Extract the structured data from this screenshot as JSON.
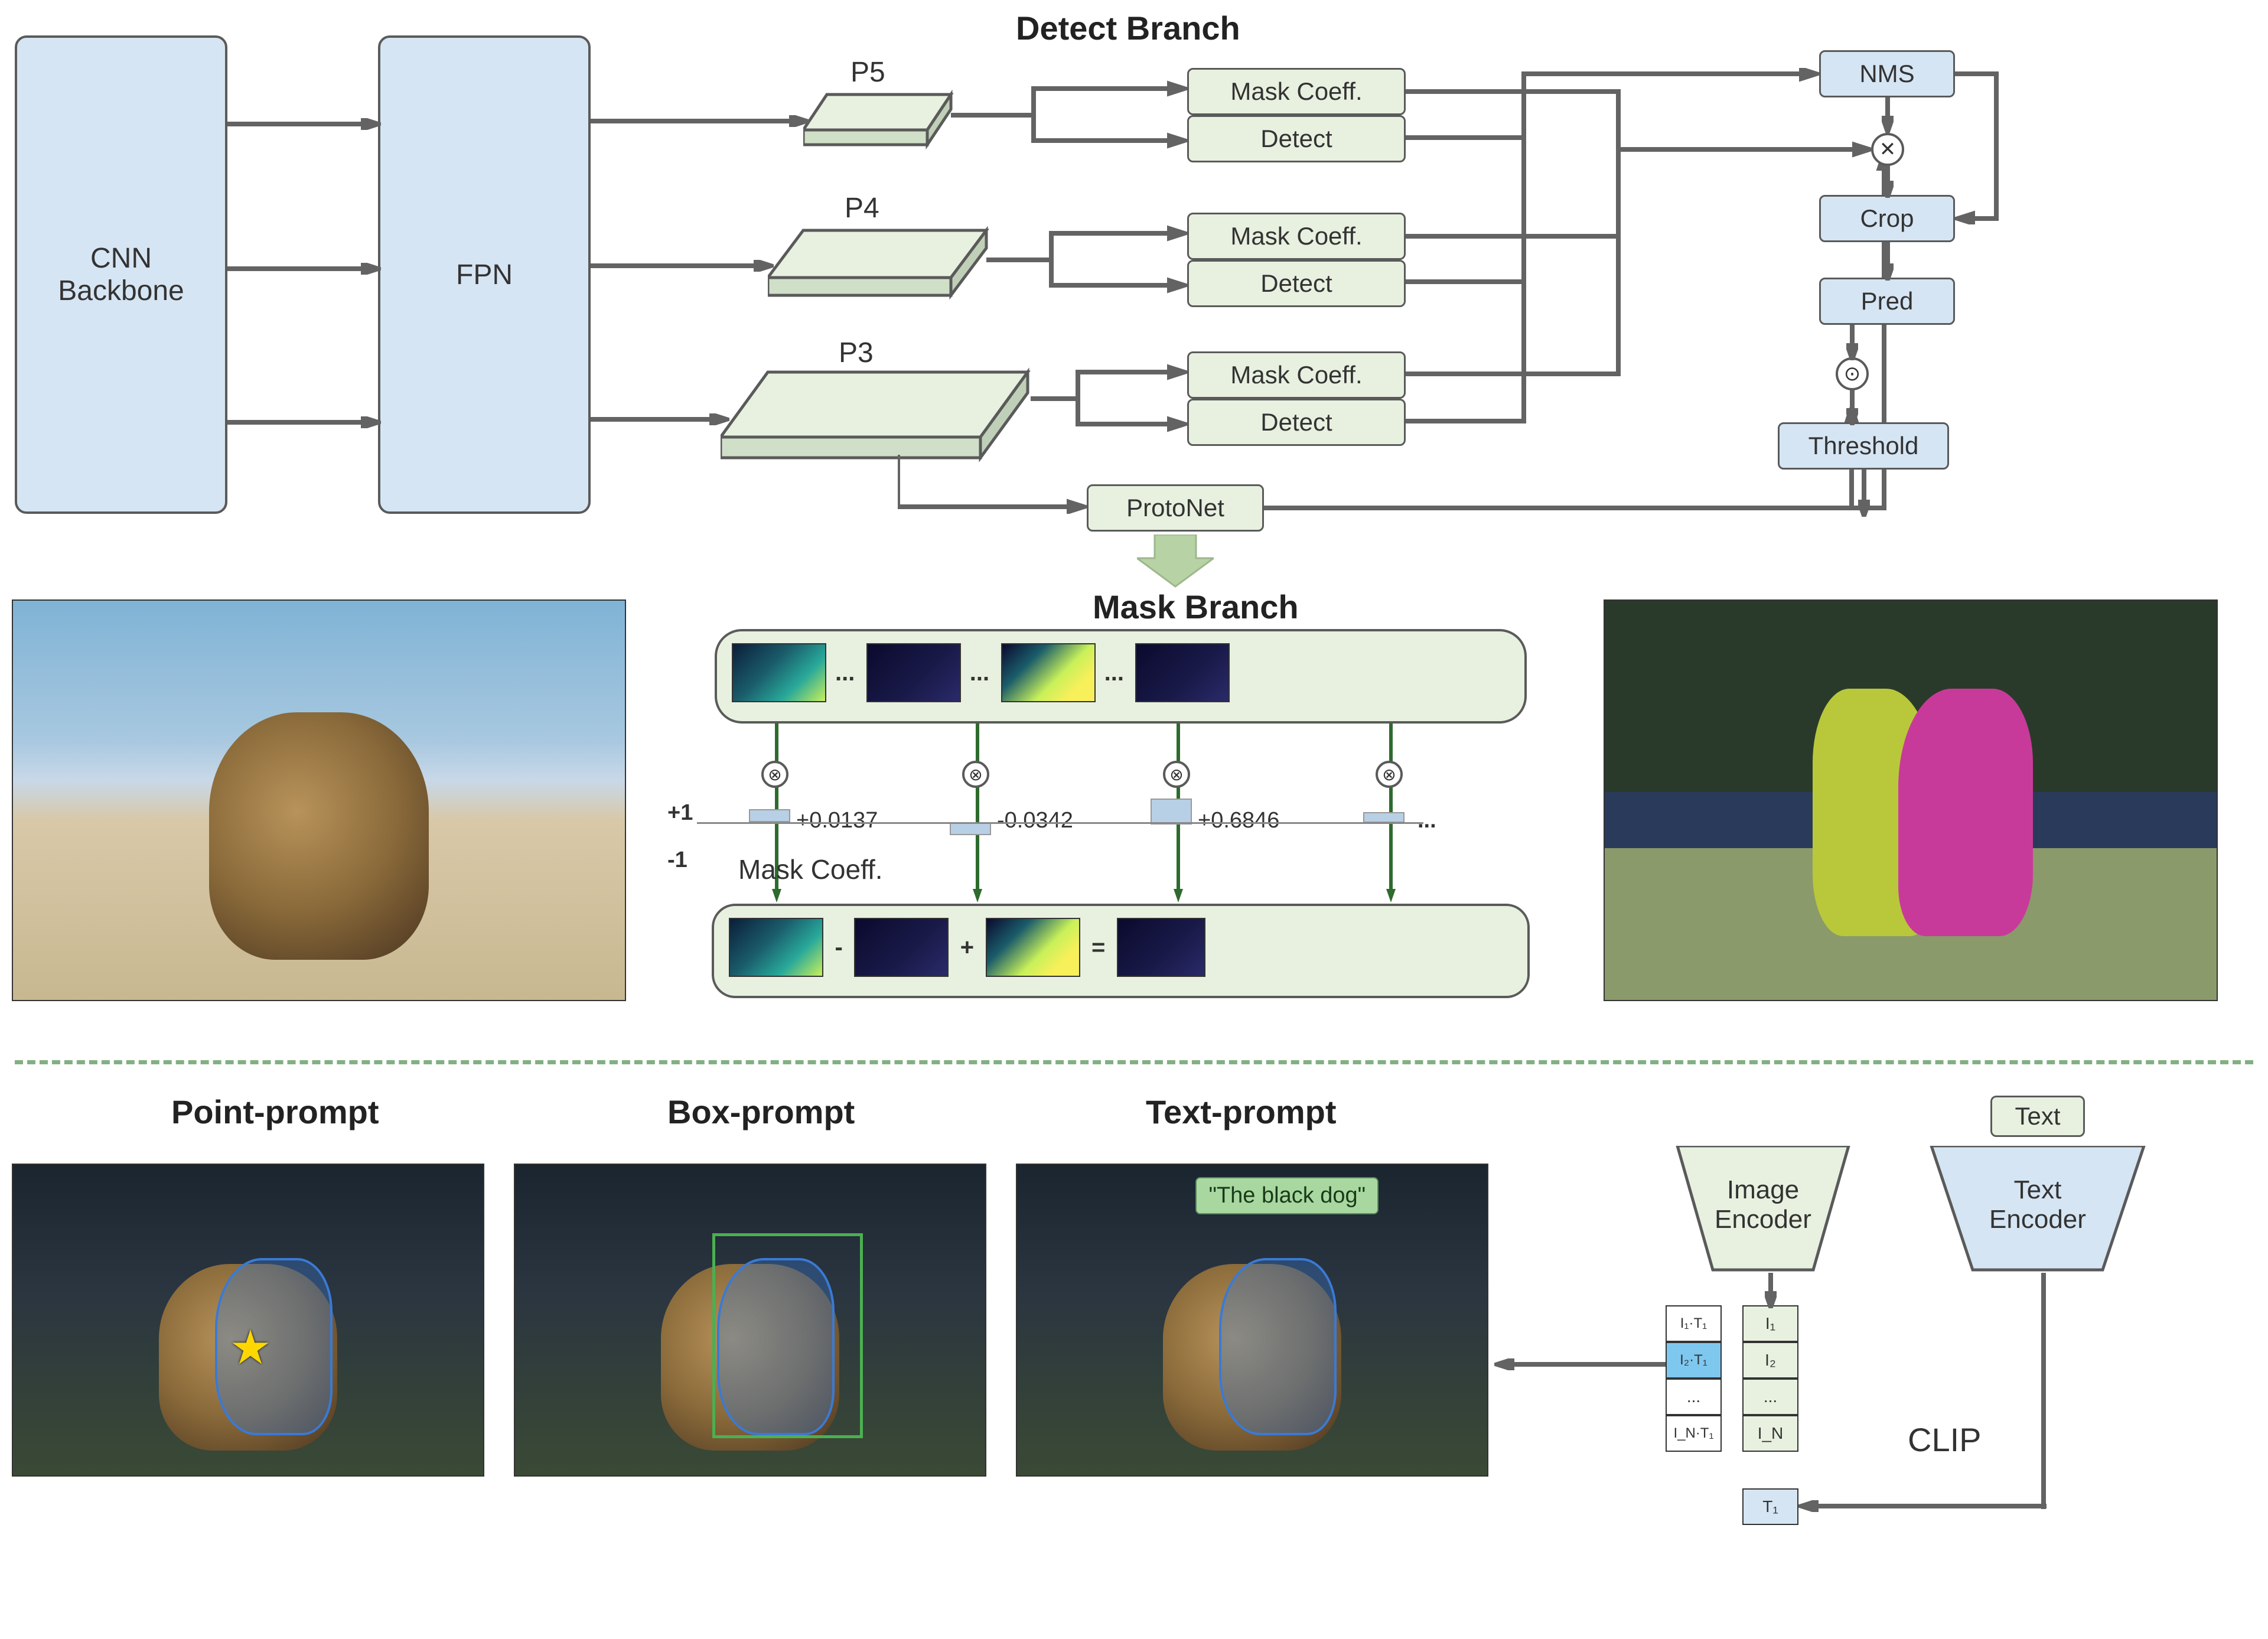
{
  "blocks": {
    "backbone": "CNN\nBackbone",
    "fpn": "FPN",
    "p5": "P5",
    "p4": "P4",
    "p3": "P3",
    "mask_coeff": "Mask Coeff.",
    "detect": "Detect",
    "protonet": "ProtoNet",
    "nms": "NMS",
    "crop": "Crop",
    "pred": "Pred",
    "threshold": "Threshold"
  },
  "titles": {
    "detect_branch": "Detect Branch",
    "mask_branch": "Mask Branch",
    "point_prompt": "Point-prompt",
    "box_prompt": "Box-prompt",
    "text_prompt": "Text-prompt"
  },
  "mask_section": {
    "axis_pos": "+1",
    "axis_neg": "-1",
    "coeff_label": "Mask Coeff.",
    "coeffs": [
      "+0.0137",
      "-0.0342",
      "+0.6846",
      "..."
    ],
    "ops": [
      "-",
      "+",
      "="
    ]
  },
  "text_prompt_label": "\"The black dog\"",
  "clip": {
    "image_encoder": "Image\nEncoder",
    "text_encoder": "Text\nEncoder",
    "text_input": "Text",
    "label": "CLIP",
    "image_feats": [
      "I₁",
      "I₂",
      "...",
      "I_N"
    ],
    "similarity": [
      "I₁·T₁",
      "I₂·T₁",
      "...",
      "I_N·T₁"
    ],
    "text_feat": "T₁"
  }
}
